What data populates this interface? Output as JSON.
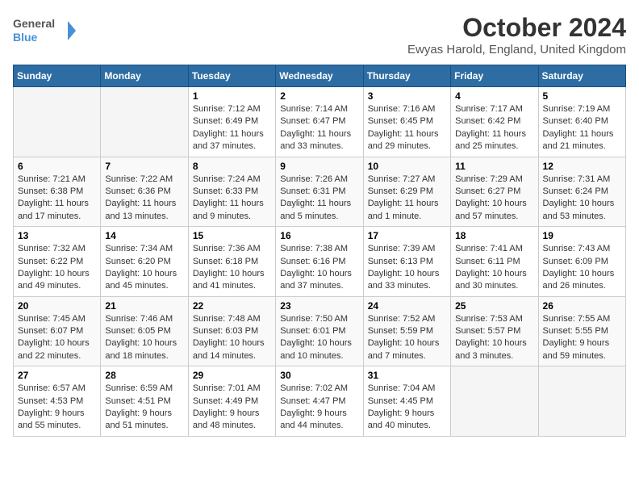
{
  "logo": {
    "line1": "General",
    "line2": "Blue"
  },
  "title": "October 2024",
  "location": "Ewyas Harold, England, United Kingdom",
  "days_of_week": [
    "Sunday",
    "Monday",
    "Tuesday",
    "Wednesday",
    "Thursday",
    "Friday",
    "Saturday"
  ],
  "weeks": [
    [
      {
        "num": "",
        "sunrise": "",
        "sunset": "",
        "daylight": ""
      },
      {
        "num": "",
        "sunrise": "",
        "sunset": "",
        "daylight": ""
      },
      {
        "num": "1",
        "sunrise": "Sunrise: 7:12 AM",
        "sunset": "Sunset: 6:49 PM",
        "daylight": "Daylight: 11 hours and 37 minutes."
      },
      {
        "num": "2",
        "sunrise": "Sunrise: 7:14 AM",
        "sunset": "Sunset: 6:47 PM",
        "daylight": "Daylight: 11 hours and 33 minutes."
      },
      {
        "num": "3",
        "sunrise": "Sunrise: 7:16 AM",
        "sunset": "Sunset: 6:45 PM",
        "daylight": "Daylight: 11 hours and 29 minutes."
      },
      {
        "num": "4",
        "sunrise": "Sunrise: 7:17 AM",
        "sunset": "Sunset: 6:42 PM",
        "daylight": "Daylight: 11 hours and 25 minutes."
      },
      {
        "num": "5",
        "sunrise": "Sunrise: 7:19 AM",
        "sunset": "Sunset: 6:40 PM",
        "daylight": "Daylight: 11 hours and 21 minutes."
      }
    ],
    [
      {
        "num": "6",
        "sunrise": "Sunrise: 7:21 AM",
        "sunset": "Sunset: 6:38 PM",
        "daylight": "Daylight: 11 hours and 17 minutes."
      },
      {
        "num": "7",
        "sunrise": "Sunrise: 7:22 AM",
        "sunset": "Sunset: 6:36 PM",
        "daylight": "Daylight: 11 hours and 13 minutes."
      },
      {
        "num": "8",
        "sunrise": "Sunrise: 7:24 AM",
        "sunset": "Sunset: 6:33 PM",
        "daylight": "Daylight: 11 hours and 9 minutes."
      },
      {
        "num": "9",
        "sunrise": "Sunrise: 7:26 AM",
        "sunset": "Sunset: 6:31 PM",
        "daylight": "Daylight: 11 hours and 5 minutes."
      },
      {
        "num": "10",
        "sunrise": "Sunrise: 7:27 AM",
        "sunset": "Sunset: 6:29 PM",
        "daylight": "Daylight: 11 hours and 1 minute."
      },
      {
        "num": "11",
        "sunrise": "Sunrise: 7:29 AM",
        "sunset": "Sunset: 6:27 PM",
        "daylight": "Daylight: 10 hours and 57 minutes."
      },
      {
        "num": "12",
        "sunrise": "Sunrise: 7:31 AM",
        "sunset": "Sunset: 6:24 PM",
        "daylight": "Daylight: 10 hours and 53 minutes."
      }
    ],
    [
      {
        "num": "13",
        "sunrise": "Sunrise: 7:32 AM",
        "sunset": "Sunset: 6:22 PM",
        "daylight": "Daylight: 10 hours and 49 minutes."
      },
      {
        "num": "14",
        "sunrise": "Sunrise: 7:34 AM",
        "sunset": "Sunset: 6:20 PM",
        "daylight": "Daylight: 10 hours and 45 minutes."
      },
      {
        "num": "15",
        "sunrise": "Sunrise: 7:36 AM",
        "sunset": "Sunset: 6:18 PM",
        "daylight": "Daylight: 10 hours and 41 minutes."
      },
      {
        "num": "16",
        "sunrise": "Sunrise: 7:38 AM",
        "sunset": "Sunset: 6:16 PM",
        "daylight": "Daylight: 10 hours and 37 minutes."
      },
      {
        "num": "17",
        "sunrise": "Sunrise: 7:39 AM",
        "sunset": "Sunset: 6:13 PM",
        "daylight": "Daylight: 10 hours and 33 minutes."
      },
      {
        "num": "18",
        "sunrise": "Sunrise: 7:41 AM",
        "sunset": "Sunset: 6:11 PM",
        "daylight": "Daylight: 10 hours and 30 minutes."
      },
      {
        "num": "19",
        "sunrise": "Sunrise: 7:43 AM",
        "sunset": "Sunset: 6:09 PM",
        "daylight": "Daylight: 10 hours and 26 minutes."
      }
    ],
    [
      {
        "num": "20",
        "sunrise": "Sunrise: 7:45 AM",
        "sunset": "Sunset: 6:07 PM",
        "daylight": "Daylight: 10 hours and 22 minutes."
      },
      {
        "num": "21",
        "sunrise": "Sunrise: 7:46 AM",
        "sunset": "Sunset: 6:05 PM",
        "daylight": "Daylight: 10 hours and 18 minutes."
      },
      {
        "num": "22",
        "sunrise": "Sunrise: 7:48 AM",
        "sunset": "Sunset: 6:03 PM",
        "daylight": "Daylight: 10 hours and 14 minutes."
      },
      {
        "num": "23",
        "sunrise": "Sunrise: 7:50 AM",
        "sunset": "Sunset: 6:01 PM",
        "daylight": "Daylight: 10 hours and 10 minutes."
      },
      {
        "num": "24",
        "sunrise": "Sunrise: 7:52 AM",
        "sunset": "Sunset: 5:59 PM",
        "daylight": "Daylight: 10 hours and 7 minutes."
      },
      {
        "num": "25",
        "sunrise": "Sunrise: 7:53 AM",
        "sunset": "Sunset: 5:57 PM",
        "daylight": "Daylight: 10 hours and 3 minutes."
      },
      {
        "num": "26",
        "sunrise": "Sunrise: 7:55 AM",
        "sunset": "Sunset: 5:55 PM",
        "daylight": "Daylight: 9 hours and 59 minutes."
      }
    ],
    [
      {
        "num": "27",
        "sunrise": "Sunrise: 6:57 AM",
        "sunset": "Sunset: 4:53 PM",
        "daylight": "Daylight: 9 hours and 55 minutes."
      },
      {
        "num": "28",
        "sunrise": "Sunrise: 6:59 AM",
        "sunset": "Sunset: 4:51 PM",
        "daylight": "Daylight: 9 hours and 51 minutes."
      },
      {
        "num": "29",
        "sunrise": "Sunrise: 7:01 AM",
        "sunset": "Sunset: 4:49 PM",
        "daylight": "Daylight: 9 hours and 48 minutes."
      },
      {
        "num": "30",
        "sunrise": "Sunrise: 7:02 AM",
        "sunset": "Sunset: 4:47 PM",
        "daylight": "Daylight: 9 hours and 44 minutes."
      },
      {
        "num": "31",
        "sunrise": "Sunrise: 7:04 AM",
        "sunset": "Sunset: 4:45 PM",
        "daylight": "Daylight: 9 hours and 40 minutes."
      },
      {
        "num": "",
        "sunrise": "",
        "sunset": "",
        "daylight": ""
      },
      {
        "num": "",
        "sunrise": "",
        "sunset": "",
        "daylight": ""
      }
    ]
  ]
}
